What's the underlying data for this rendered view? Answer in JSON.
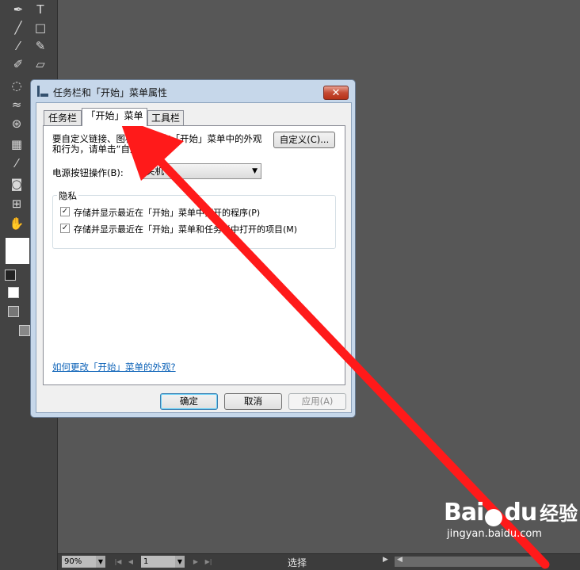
{
  "dialog": {
    "title": "任务栏和「开始」菜单属性",
    "close_glyph": "✕",
    "tabs": [
      {
        "label": "任务栏"
      },
      {
        "label": "「开始」菜单"
      },
      {
        "label": "工具栏"
      }
    ],
    "description": "要自定义链接、图标和菜单在「开始」菜单中的外观和行为，请单击“自定义”。",
    "customize_button": "自定义(C)...",
    "power_label": "电源按钮操作(B):",
    "power_value": "关机",
    "privacy_group": "隐私",
    "checkbox1": "存储并显示最近在「开始」菜单中打开的程序(P)",
    "checkbox2": "存储并显示最近在「开始」菜单和任务栏中打开的项目(M)",
    "help_link": "如何更改「开始」菜单的外观?",
    "ok_button": "确定",
    "cancel_button": "取消",
    "apply_button": "应用(A)"
  },
  "statusbar": {
    "zoom": "90%",
    "page": "1",
    "status": "选择"
  },
  "watermark": {
    "logo": "Bai",
    "logo2": "du",
    "cn": "经验",
    "url": "jingyan.baidu.com"
  },
  "colors": {
    "arrow": "#ff1a1a",
    "workspace": "#575757",
    "toolbar": "#434343"
  }
}
